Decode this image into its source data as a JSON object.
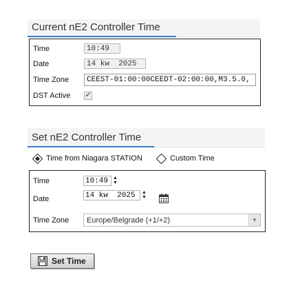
{
  "current": {
    "title": "Current nE2 Controller Time",
    "time_label": "Time",
    "time_value": "10:49",
    "date_label": "Date",
    "date_value": "14 kw  2025",
    "tz_label": "Time Zone",
    "tz_value": "CEEST-01:00:00CEEDT-02:00:00,M3.5.0,",
    "dst_label": "DST Active",
    "dst_checked": true
  },
  "set": {
    "title": "Set nE2 Controller Time",
    "radio_station": "Time from Niagara STATION",
    "radio_custom": "Custom Time",
    "selected": "station",
    "time_label": "Time",
    "time_value": "10:49",
    "date_label": "Date",
    "date_value": "14 kw  2025",
    "tz_label": "Time Zone",
    "tz_value": "Europe/Belgrade (+1/+2)",
    "button_label": "Set Time"
  },
  "colors": {
    "accent": "#3c78c8",
    "border": "#222222"
  },
  "icons": [
    "checkmark-icon",
    "spinner-icon",
    "calendar-icon",
    "dropdown-arrow-icon",
    "save-icon"
  ]
}
